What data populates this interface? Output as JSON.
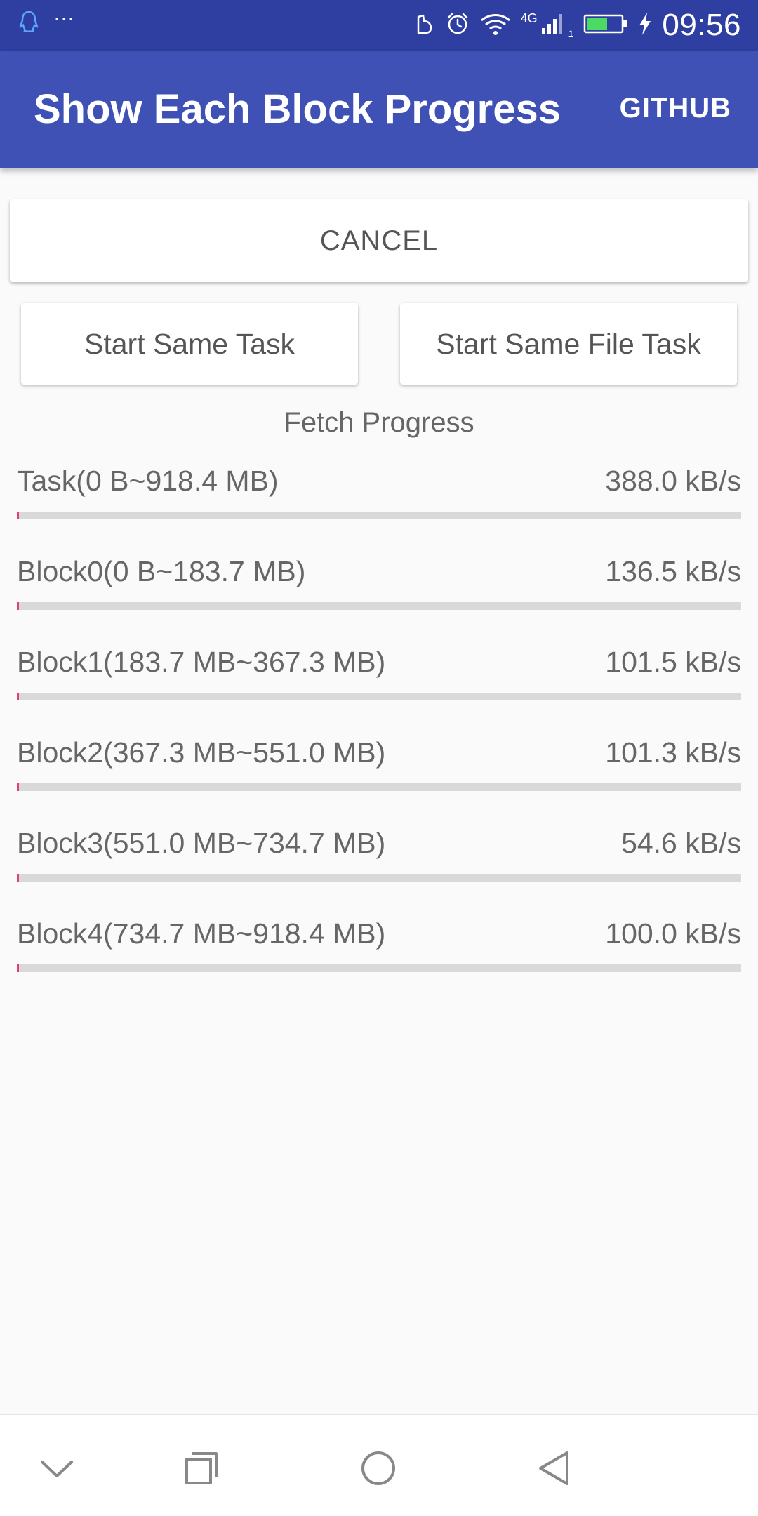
{
  "status_bar": {
    "time": "09:56",
    "network": "4G",
    "sim": "1",
    "icons": [
      "qq-icon",
      "more-dots-icon",
      "notification-icon",
      "alarm-icon",
      "wifi-icon",
      "signal-icon",
      "battery-icon",
      "charging-icon"
    ],
    "battery_level": 0.6
  },
  "app_bar": {
    "title": "Show Each Block Progress",
    "action_label": "GITHUB"
  },
  "buttons": {
    "cancel": "CANCEL",
    "start_same_task": "Start Same Task",
    "start_same_file_task": "Start Same File Task"
  },
  "fetch_title": "Fetch Progress",
  "progress": [
    {
      "label": "Task(0 B~918.4 MB)",
      "speed": "388.0 kB/s",
      "fraction": 0.003
    },
    {
      "label": "Block0(0 B~183.7 MB)",
      "speed": "136.5 kB/s",
      "fraction": 0.003
    },
    {
      "label": "Block1(183.7 MB~367.3 MB)",
      "speed": "101.5 kB/s",
      "fraction": 0.003
    },
    {
      "label": "Block2(367.3 MB~551.0 MB)",
      "speed": "101.3 kB/s",
      "fraction": 0.003
    },
    {
      "label": "Block3(551.0 MB~734.7 MB)",
      "speed": "54.6 kB/s",
      "fraction": 0.003
    },
    {
      "label": "Block4(734.7 MB~918.4 MB)",
      "speed": "100.0 kB/s",
      "fraction": 0.003
    }
  ],
  "colors": {
    "status_bar": "#2f3fa1",
    "app_bar": "#3f51b5",
    "progress_fill": "#e0407a",
    "progress_track": "#d9d9d9"
  },
  "nav_bar": {
    "icons": [
      "chevron-down-icon",
      "recents-icon",
      "home-icon",
      "back-icon"
    ]
  }
}
